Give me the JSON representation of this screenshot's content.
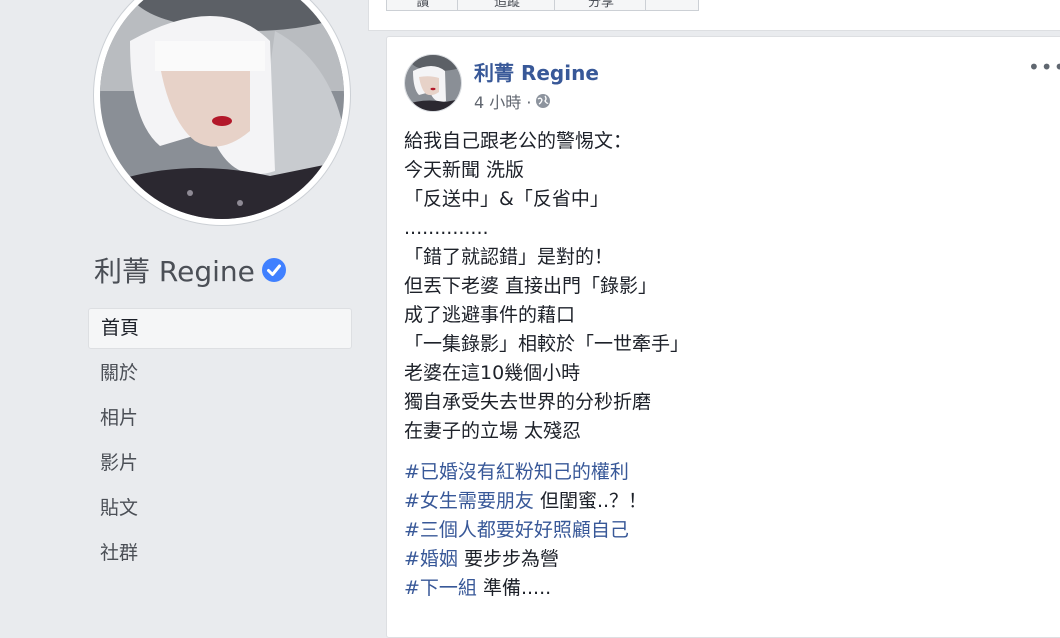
{
  "page": {
    "name": "利菁 Regine",
    "nav": [
      "首頁",
      "關於",
      "相片",
      "影片",
      "貼文",
      "社群"
    ]
  },
  "tabs": [
    "讚",
    "追蹤",
    "分享",
    ""
  ],
  "post": {
    "author": "利菁 Regine",
    "time": "4 小時 ·",
    "more": "•••",
    "lines": [
      "給我自己跟老公的警惕文：",
      "今天新聞 洗版",
      "「反送中」&「反省中」",
      "..............",
      "「錯了就認錯」是對的！",
      "但丟下老婆 直接出門「錄影」",
      "成了逃避事件的藉口",
      "「一集錄影」相較於「一世牽手」",
      "老婆在這10幾個小時",
      "獨自承受失去世界的分秒折磨",
      "在妻子的立場 太殘忍"
    ],
    "hashtags": [
      {
        "tag": "#已婚沒有紅粉知己的權利",
        "rest": ""
      },
      {
        "tag": "#女生需要朋友",
        "rest": " 但閨蜜..？！"
      },
      {
        "tag": "#三個人都要好好照顧自己",
        "rest": ""
      },
      {
        "tag": "#婚姻",
        "rest": " 要步步為營"
      },
      {
        "tag": "#下一組",
        "rest": " 準備....."
      }
    ]
  },
  "colors": {
    "link": "#385898",
    "verified": "#4080ff",
    "background": "#e9ebee"
  },
  "icons": [
    "verified-badge-icon",
    "globe-icon",
    "more-options-icon"
  ]
}
